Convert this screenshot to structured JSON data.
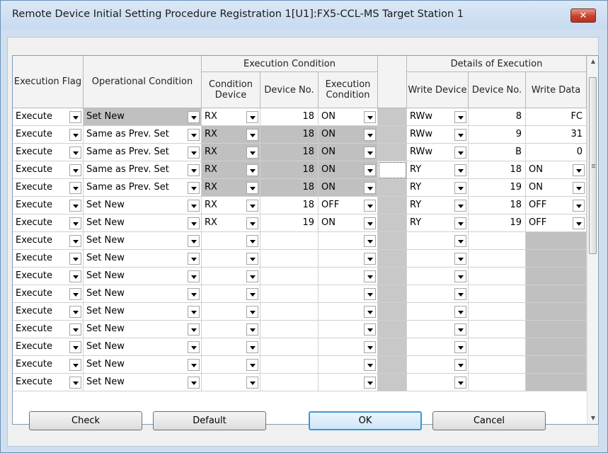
{
  "window": {
    "title": "Remote Device Initial Setting Procedure Registration  1[U1]:FX5-CCL-MS Target Station 1",
    "close_label": "✕"
  },
  "headers": {
    "execution_flag": "Execution Flag",
    "operational_condition": "Operational Condition",
    "execution_condition_group": "Execution Condition",
    "condition_device": "Condition Device",
    "cond_device_no": "Device No.",
    "execution_condition": "Execution Condition",
    "details_group": "Details of Execution",
    "write_device": "Write Device",
    "write_device_no": "Device No.",
    "write_data": "Write Data"
  },
  "rows": [
    {
      "flag": "Execute",
      "op": "Set New",
      "cdev": "RX",
      "cno": "18",
      "econd": "ON",
      "wdev": "RWw",
      "wno": "8",
      "wdata": "FC",
      "wdata_dd": false,
      "cond_gray": false,
      "op_gray": true,
      "sep_sel": false
    },
    {
      "flag": "Execute",
      "op": "Same as Prev. Set",
      "cdev": "RX",
      "cno": "18",
      "econd": "ON",
      "wdev": "RWw",
      "wno": "9",
      "wdata": "31",
      "wdata_dd": false,
      "cond_gray": true,
      "op_gray": false,
      "sep_sel": false
    },
    {
      "flag": "Execute",
      "op": "Same as Prev. Set",
      "cdev": "RX",
      "cno": "18",
      "econd": "ON",
      "wdev": "RWw",
      "wno": "B",
      "wdata": "0",
      "wdata_dd": false,
      "cond_gray": true,
      "op_gray": false,
      "sep_sel": false
    },
    {
      "flag": "Execute",
      "op": "Same as Prev. Set",
      "cdev": "RX",
      "cno": "18",
      "econd": "ON",
      "wdev": "RY",
      "wno": "18",
      "wdata": "ON",
      "wdata_dd": true,
      "cond_gray": true,
      "op_gray": false,
      "sep_sel": true
    },
    {
      "flag": "Execute",
      "op": "Same as Prev. Set",
      "cdev": "RX",
      "cno": "18",
      "econd": "ON",
      "wdev": "RY",
      "wno": "19",
      "wdata": "ON",
      "wdata_dd": true,
      "cond_gray": true,
      "op_gray": false,
      "sep_sel": false
    },
    {
      "flag": "Execute",
      "op": "Set New",
      "cdev": "RX",
      "cno": "18",
      "econd": "OFF",
      "wdev": "RY",
      "wno": "18",
      "wdata": "OFF",
      "wdata_dd": true,
      "cond_gray": false,
      "op_gray": false,
      "sep_sel": false
    },
    {
      "flag": "Execute",
      "op": "Set New",
      "cdev": "RX",
      "cno": "19",
      "econd": "ON",
      "wdev": "RY",
      "wno": "19",
      "wdata": "OFF",
      "wdata_dd": true,
      "cond_gray": false,
      "op_gray": false,
      "sep_sel": false
    },
    {
      "flag": "Execute",
      "op": "Set New",
      "cdev": "",
      "cno": "",
      "econd": "",
      "wdev": "",
      "wno": "",
      "wdata": "",
      "wdata_dd": false,
      "cond_gray": false,
      "op_gray": false,
      "sep_sel": false,
      "wdata_gray": true
    },
    {
      "flag": "Execute",
      "op": "Set New",
      "cdev": "",
      "cno": "",
      "econd": "",
      "wdev": "",
      "wno": "",
      "wdata": "",
      "wdata_dd": false,
      "cond_gray": false,
      "op_gray": false,
      "sep_sel": false,
      "wdata_gray": true
    },
    {
      "flag": "Execute",
      "op": "Set New",
      "cdev": "",
      "cno": "",
      "econd": "",
      "wdev": "",
      "wno": "",
      "wdata": "",
      "wdata_dd": false,
      "cond_gray": false,
      "op_gray": false,
      "sep_sel": false,
      "wdata_gray": true
    },
    {
      "flag": "Execute",
      "op": "Set New",
      "cdev": "",
      "cno": "",
      "econd": "",
      "wdev": "",
      "wno": "",
      "wdata": "",
      "wdata_dd": false,
      "cond_gray": false,
      "op_gray": false,
      "sep_sel": false,
      "wdata_gray": true
    },
    {
      "flag": "Execute",
      "op": "Set New",
      "cdev": "",
      "cno": "",
      "econd": "",
      "wdev": "",
      "wno": "",
      "wdata": "",
      "wdata_dd": false,
      "cond_gray": false,
      "op_gray": false,
      "sep_sel": false,
      "wdata_gray": true
    },
    {
      "flag": "Execute",
      "op": "Set New",
      "cdev": "",
      "cno": "",
      "econd": "",
      "wdev": "",
      "wno": "",
      "wdata": "",
      "wdata_dd": false,
      "cond_gray": false,
      "op_gray": false,
      "sep_sel": false,
      "wdata_gray": true
    },
    {
      "flag": "Execute",
      "op": "Set New",
      "cdev": "",
      "cno": "",
      "econd": "",
      "wdev": "",
      "wno": "",
      "wdata": "",
      "wdata_dd": false,
      "cond_gray": false,
      "op_gray": false,
      "sep_sel": false,
      "wdata_gray": true
    },
    {
      "flag": "Execute",
      "op": "Set New",
      "cdev": "",
      "cno": "",
      "econd": "",
      "wdev": "",
      "wno": "",
      "wdata": "",
      "wdata_dd": false,
      "cond_gray": false,
      "op_gray": false,
      "sep_sel": false,
      "wdata_gray": true
    },
    {
      "flag": "Execute",
      "op": "Set New",
      "cdev": "",
      "cno": "",
      "econd": "",
      "wdev": "",
      "wno": "",
      "wdata": "",
      "wdata_dd": false,
      "cond_gray": false,
      "op_gray": false,
      "sep_sel": false,
      "wdata_gray": true
    }
  ],
  "buttons": {
    "check": "Check",
    "default": "Default",
    "ok": "OK",
    "cancel": "Cancel"
  },
  "scrollbar": {
    "up_icon": "triangle-up-icon",
    "down_icon": "triangle-down-icon"
  }
}
